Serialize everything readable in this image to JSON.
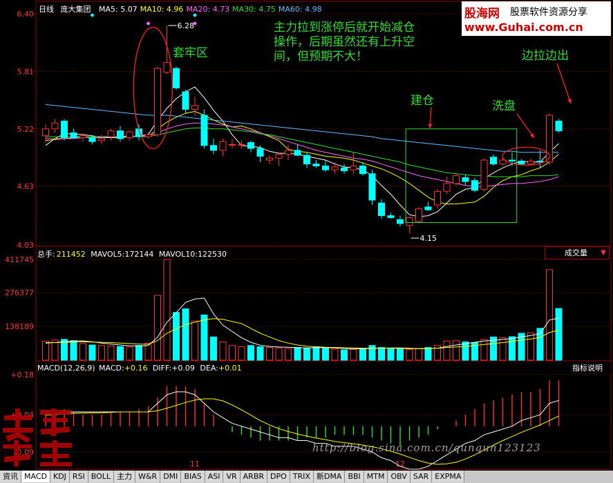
{
  "header": {
    "period": "日线",
    "stock_name": "庞大集团",
    "ma_items": [
      {
        "label": "MA5:",
        "value": "5.07",
        "color": "#ffffff"
      },
      {
        "label": "MA10:",
        "value": "4.96",
        "color": "#ffff00"
      },
      {
        "label": "MA20:",
        "value": "4.73",
        "color": "#ff66ff"
      },
      {
        "label": "MA30:",
        "value": "4.75",
        "color": "#33dd33"
      },
      {
        "label": "MA60:",
        "value": "4.98",
        "color": "#66bbff"
      }
    ]
  },
  "brand": {
    "name": "股海网",
    "slogan": "股票软件资源分享",
    "url": "www.Guhai.com.cn"
  },
  "annotations": {
    "trap_zone": "套牢区",
    "note_line1": "主力拉到涨停后就开始减仓",
    "note_line2": "操作，后期虽然还有上升空",
    "note_line3": "间，但预期不大！",
    "build": "建仓",
    "wash": "洗盘",
    "pull_out": "边拉边出",
    "high_label": "6.28",
    "low_label": "4.15"
  },
  "volume_header": {
    "title": "总手:",
    "total": "211452",
    "mavol5_label": "MAVOL5:",
    "mavol5": "172144",
    "mavol10_label": "MAVOL10:",
    "mavol10": "122530",
    "dropdown": "成交量"
  },
  "macd_header": {
    "title": "MACD(12,26,9)",
    "macd_label": "MACD:",
    "macd": "+0.16",
    "diff_label": "DIFF:",
    "diff": "+0.09",
    "dea_label": "DEA:",
    "dea": "+0.01",
    "button": "指标说明"
  },
  "watermark": "http://blog.sina.com.cn/qunqun123123",
  "seal_text": "英雄股庄",
  "tabs": [
    "资讯",
    "MACD",
    "KDJ",
    "RSI",
    "BOLL",
    "主力",
    "W&R",
    "DMI",
    "BIAS",
    "ASI",
    "VR",
    "ARBR",
    "DPO",
    "TRIX",
    "新DMA",
    "BBI",
    "MTM",
    "OBV",
    "SAR",
    "EXPMA"
  ],
  "active_tab": "MACD",
  "chart_data": {
    "type": "candlestick",
    "price_axis": {
      "ticks": [
        "6.40",
        "5.81",
        "5.22",
        "4.63",
        "4.03"
      ],
      "ylim": [
        4.03,
        6.4
      ]
    },
    "volume_axis": {
      "ticks": [
        "411745",
        "276377",
        "138189"
      ]
    },
    "macd_axis": {
      "ticks": [
        "+0.18",
        "+0.04",
        "-0.09"
      ]
    },
    "x_ticks": [
      {
        "label": "11",
        "index": 16
      },
      {
        "label": "12",
        "index": 38
      }
    ],
    "colors": {
      "up": "#ff3333",
      "down": "#00ffff",
      "ma5": "#ffffff",
      "ma10": "#ffff00",
      "ma20": "#ff66ff",
      "ma30": "#33dd33",
      "ma60": "#66bbff",
      "grid": "#8b0000"
    },
    "candles": [
      {
        "o": 5.15,
        "h": 5.27,
        "l": 5.08,
        "c": 5.22
      },
      {
        "o": 5.22,
        "h": 5.32,
        "l": 5.18,
        "c": 5.28
      },
      {
        "o": 5.3,
        "h": 5.32,
        "l": 5.1,
        "c": 5.13
      },
      {
        "o": 5.18,
        "h": 5.22,
        "l": 5.12,
        "c": 5.13
      },
      {
        "o": 5.13,
        "h": 5.18,
        "l": 5.09,
        "c": 5.15
      },
      {
        "o": 5.13,
        "h": 5.15,
        "l": 5.06,
        "c": 5.09
      },
      {
        "o": 5.1,
        "h": 5.16,
        "l": 5.06,
        "c": 5.12
      },
      {
        "o": 5.14,
        "h": 5.22,
        "l": 5.1,
        "c": 5.2
      },
      {
        "o": 5.2,
        "h": 5.25,
        "l": 5.09,
        "c": 5.12
      },
      {
        "o": 5.13,
        "h": 5.2,
        "l": 5.1,
        "c": 5.19
      },
      {
        "o": 5.22,
        "h": 5.27,
        "l": 5.1,
        "c": 5.14
      },
      {
        "o": 5.14,
        "h": 5.19,
        "l": 5.12,
        "c": 5.16
      },
      {
        "o": 5.16,
        "h": 5.86,
        "l": 5.14,
        "c": 5.84
      },
      {
        "o": 5.8,
        "h": 6.28,
        "l": 5.78,
        "c": 5.9
      },
      {
        "o": 5.84,
        "h": 5.86,
        "l": 5.62,
        "c": 5.64
      },
      {
        "o": 5.6,
        "h": 5.62,
        "l": 5.38,
        "c": 5.42
      },
      {
        "o": 5.42,
        "h": 5.55,
        "l": 5.35,
        "c": 5.46
      },
      {
        "o": 5.36,
        "h": 5.42,
        "l": 5.02,
        "c": 5.05
      },
      {
        "o": 5.05,
        "h": 5.12,
        "l": 4.96,
        "c": 5.0
      },
      {
        "o": 5.0,
        "h": 5.12,
        "l": 4.94,
        "c": 5.09
      },
      {
        "o": 5.06,
        "h": 5.12,
        "l": 5.02,
        "c": 5.06
      },
      {
        "o": 5.06,
        "h": 5.1,
        "l": 5.02,
        "c": 5.06
      },
      {
        "o": 5.08,
        "h": 5.1,
        "l": 4.98,
        "c": 5.02
      },
      {
        "o": 5.02,
        "h": 5.05,
        "l": 4.88,
        "c": 4.94
      },
      {
        "o": 4.9,
        "h": 4.95,
        "l": 4.86,
        "c": 4.92
      },
      {
        "o": 4.92,
        "h": 4.98,
        "l": 4.84,
        "c": 4.96
      },
      {
        "o": 4.96,
        "h": 5.06,
        "l": 4.9,
        "c": 5.0
      },
      {
        "o": 5.0,
        "h": 5.06,
        "l": 4.94,
        "c": 4.95
      },
      {
        "o": 4.95,
        "h": 4.98,
        "l": 4.82,
        "c": 4.86
      },
      {
        "o": 4.86,
        "h": 4.9,
        "l": 4.82,
        "c": 4.84
      },
      {
        "o": 4.84,
        "h": 4.9,
        "l": 4.78,
        "c": 4.8
      },
      {
        "o": 4.8,
        "h": 4.88,
        "l": 4.76,
        "c": 4.83
      },
      {
        "o": 4.82,
        "h": 4.86,
        "l": 4.76,
        "c": 4.79
      },
      {
        "o": 4.8,
        "h": 4.98,
        "l": 4.76,
        "c": 4.84
      },
      {
        "o": 4.84,
        "h": 4.88,
        "l": 4.74,
        "c": 4.76
      },
      {
        "o": 4.76,
        "h": 4.8,
        "l": 4.44,
        "c": 4.49
      },
      {
        "o": 4.46,
        "h": 4.5,
        "l": 4.3,
        "c": 4.33
      },
      {
        "o": 4.33,
        "h": 4.36,
        "l": 4.3,
        "c": 4.31
      },
      {
        "o": 4.29,
        "h": 4.33,
        "l": 4.22,
        "c": 4.25
      },
      {
        "o": 4.23,
        "h": 4.32,
        "l": 4.15,
        "c": 4.31
      },
      {
        "o": 4.27,
        "h": 4.42,
        "l": 4.25,
        "c": 4.4
      },
      {
        "o": 4.42,
        "h": 4.47,
        "l": 4.38,
        "c": 4.39
      },
      {
        "o": 4.44,
        "h": 4.6,
        "l": 4.4,
        "c": 4.58
      },
      {
        "o": 4.58,
        "h": 4.73,
        "l": 4.55,
        "c": 4.66
      },
      {
        "o": 4.66,
        "h": 4.76,
        "l": 4.64,
        "c": 4.74
      },
      {
        "o": 4.72,
        "h": 4.75,
        "l": 4.64,
        "c": 4.68
      },
      {
        "o": 4.69,
        "h": 4.72,
        "l": 4.57,
        "c": 4.59
      },
      {
        "o": 4.6,
        "h": 4.92,
        "l": 4.58,
        "c": 4.9
      },
      {
        "o": 4.93,
        "h": 4.96,
        "l": 4.84,
        "c": 4.86
      },
      {
        "o": 4.86,
        "h": 4.92,
        "l": 4.84,
        "c": 4.9
      },
      {
        "o": 4.9,
        "h": 4.98,
        "l": 4.84,
        "c": 4.89
      },
      {
        "o": 4.89,
        "h": 4.91,
        "l": 4.85,
        "c": 4.86
      },
      {
        "o": 4.86,
        "h": 4.92,
        "l": 4.85,
        "c": 4.89
      },
      {
        "o": 4.89,
        "h": 5.0,
        "l": 4.82,
        "c": 4.88
      },
      {
        "o": 4.88,
        "h": 5.38,
        "l": 4.85,
        "c": 5.36
      },
      {
        "o": 5.3,
        "h": 5.32,
        "l": 5.18,
        "c": 5.2
      }
    ],
    "ma_series": [
      {
        "key": "ma5",
        "color": "#ffffff",
        "values": [
          5.05,
          5.12,
          5.17,
          5.17,
          5.16,
          5.15,
          5.13,
          5.13,
          5.13,
          5.14,
          5.15,
          5.16,
          5.31,
          5.43,
          5.53,
          5.6,
          5.65,
          5.54,
          5.41,
          5.3,
          5.16,
          5.05,
          5.04,
          5.03,
          4.99,
          4.97,
          4.97,
          4.96,
          4.94,
          4.92,
          4.9,
          4.86,
          4.83,
          4.82,
          4.8,
          4.74,
          4.64,
          4.55,
          4.44,
          4.34,
          4.32,
          4.33,
          4.37,
          4.46,
          4.55,
          4.6,
          4.62,
          4.71,
          4.77,
          4.82,
          4.86,
          4.89,
          4.88,
          4.88,
          4.98,
          5.07
        ]
      },
      {
        "key": "ma10",
        "color": "#ffff00",
        "values": [
          5.1,
          5.11,
          5.12,
          5.13,
          5.14,
          5.14,
          5.14,
          5.14,
          5.14,
          5.15,
          5.14,
          5.14,
          5.22,
          5.29,
          5.34,
          5.38,
          5.4,
          5.36,
          5.31,
          5.27,
          5.24,
          5.25,
          5.22,
          5.18,
          5.14,
          5.1,
          5.01,
          4.99,
          4.98,
          4.96,
          4.94,
          4.93,
          4.92,
          4.9,
          4.87,
          4.84,
          4.81,
          4.77,
          4.72,
          4.66,
          4.59,
          4.52,
          4.47,
          4.45,
          4.45,
          4.46,
          4.47,
          4.53,
          4.62,
          4.69,
          4.73,
          4.75,
          4.79,
          4.82,
          4.88,
          4.96
        ]
      },
      {
        "key": "ma20",
        "color": "#ff66ff",
        "values": [
          5.12,
          5.12,
          5.12,
          5.12,
          5.13,
          5.13,
          5.13,
          5.14,
          5.14,
          5.14,
          5.15,
          5.15,
          5.18,
          5.22,
          5.25,
          5.27,
          5.28,
          5.28,
          5.27,
          5.26,
          5.24,
          5.22,
          5.2,
          5.18,
          5.15,
          5.12,
          5.09,
          5.06,
          5.03,
          5.0,
          4.98,
          4.96,
          4.94,
          4.92,
          4.91,
          4.89,
          4.86,
          4.83,
          4.8,
          4.77,
          4.74,
          4.72,
          4.7,
          4.68,
          4.66,
          4.64,
          4.63,
          4.63,
          4.64,
          4.65,
          4.66,
          4.66,
          4.67,
          4.68,
          4.7,
          4.73
        ]
      },
      {
        "key": "ma30",
        "color": "#33dd33",
        "values": [
          5.14,
          5.14,
          5.14,
          5.14,
          5.14,
          5.14,
          5.14,
          5.14,
          5.14,
          5.14,
          5.14,
          5.14,
          5.16,
          5.18,
          5.2,
          5.22,
          5.23,
          5.23,
          5.22,
          5.22,
          5.21,
          5.2,
          5.19,
          5.17,
          5.16,
          5.14,
          5.12,
          5.1,
          5.08,
          5.06,
          5.04,
          5.02,
          5.0,
          4.98,
          4.96,
          4.94,
          4.92,
          4.9,
          4.88,
          4.85,
          4.83,
          4.81,
          4.79,
          4.77,
          4.76,
          4.75,
          4.74,
          4.74,
          4.73,
          4.73,
          4.73,
          4.73,
          4.74,
          4.74,
          4.74,
          4.75
        ]
      },
      {
        "key": "ma60",
        "color": "#66bbff",
        "values": [
          5.47,
          5.46,
          5.45,
          5.44,
          5.43,
          5.42,
          5.41,
          5.4,
          5.39,
          5.38,
          5.37,
          5.36,
          5.36,
          5.36,
          5.35,
          5.34,
          5.33,
          5.32,
          5.31,
          5.3,
          5.29,
          5.28,
          5.27,
          5.26,
          5.25,
          5.24,
          5.23,
          5.22,
          5.21,
          5.2,
          5.19,
          5.18,
          5.17,
          5.16,
          5.15,
          5.14,
          5.12,
          5.11,
          5.1,
          5.09,
          5.08,
          5.07,
          5.06,
          5.05,
          5.04,
          5.03,
          5.02,
          5.01,
          5.0,
          4.99,
          4.99,
          4.98,
          4.98,
          4.98,
          4.98,
          4.98
        ]
      }
    ],
    "volume": [
      78000,
      82000,
      85000,
      80000,
      68000,
      62000,
      60000,
      58000,
      56000,
      54000,
      60000,
      70000,
      265000,
      411745,
      195000,
      210000,
      160000,
      185000,
      95000,
      75000,
      60000,
      55000,
      60000,
      55000,
      52000,
      50000,
      48000,
      52000,
      50000,
      55000,
      48000,
      45000,
      42000,
      44000,
      48000,
      60000,
      52000,
      48000,
      45000,
      44000,
      48000,
      52000,
      60000,
      78000,
      80000,
      75000,
      72000,
      85000,
      95000,
      92000,
      96000,
      110000,
      112000,
      130000,
      370000,
      211452
    ],
    "mavol5": [
      70000,
      72000,
      75000,
      78000,
      79000,
      75000,
      70000,
      66000,
      62000,
      59000,
      58000,
      60000,
      94000,
      155000,
      194000,
      236000,
      250000,
      254000,
      189000,
      143000,
      117000,
      92000,
      73000,
      61000,
      56000,
      54000,
      53000,
      51000,
      50000,
      51000,
      51000,
      50000,
      47000,
      46000,
      47000,
      48000,
      49000,
      50000,
      50000,
      49000,
      47000,
      47000,
      49000,
      56000,
      62000,
      67000,
      73000,
      78000,
      81000,
      85000,
      88000,
      95000,
      101000,
      108000,
      164000,
      172144
    ],
    "mavol10": [
      72000,
      72000,
      73000,
      74000,
      75000,
      74000,
      73000,
      72000,
      70000,
      68000,
      66000,
      65000,
      80000,
      110000,
      128000,
      145000,
      155000,
      165000,
      170000,
      167000,
      158000,
      150000,
      130000,
      110000,
      95000,
      80000,
      70000,
      62000,
      57000,
      55000,
      53000,
      52000,
      51000,
      50000,
      49000,
      49000,
      49000,
      49000,
      48000,
      47000,
      47000,
      48000,
      49000,
      52000,
      54000,
      56000,
      60000,
      64000,
      68000,
      72000,
      77000,
      82000,
      87000,
      93000,
      113000,
      122530
    ],
    "macd_hist": [
      0.04,
      0.05,
      0.06,
      0.05,
      0.04,
      0.04,
      0.04,
      0.05,
      0.05,
      0.05,
      0.06,
      0.07,
      0.1,
      0.14,
      0.14,
      0.14,
      0.13,
      0.08,
      0.04,
      0.0,
      -0.02,
      -0.03,
      -0.04,
      -0.05,
      -0.05,
      -0.05,
      -0.05,
      -0.05,
      -0.04,
      -0.04,
      -0.04,
      -0.03,
      -0.03,
      -0.03,
      -0.03,
      -0.04,
      -0.05,
      -0.06,
      -0.07,
      -0.05,
      -0.04,
      -0.03,
      -0.01,
      0.0,
      0.02,
      0.04,
      0.06,
      0.08,
      0.09,
      0.1,
      0.11,
      0.12,
      0.12,
      0.13,
      0.16,
      0.16
    ],
    "macd_diff": [
      0.04,
      0.04,
      0.05,
      0.05,
      0.05,
      0.05,
      0.05,
      0.05,
      0.05,
      0.05,
      0.05,
      0.05,
      0.08,
      0.11,
      0.12,
      0.12,
      0.11,
      0.08,
      0.05,
      0.03,
      0.01,
      0.0,
      -0.01,
      -0.02,
      -0.03,
      -0.04,
      -0.04,
      -0.05,
      -0.05,
      -0.06,
      -0.06,
      -0.07,
      -0.07,
      -0.07,
      -0.08,
      -0.09,
      -0.11,
      -0.12,
      -0.14,
      -0.15,
      -0.15,
      -0.14,
      -0.12,
      -0.1,
      -0.08,
      -0.06,
      -0.05,
      -0.03,
      -0.02,
      -0.01,
      0.0,
      0.02,
      0.03,
      0.04,
      0.08,
      0.09
    ]
  }
}
